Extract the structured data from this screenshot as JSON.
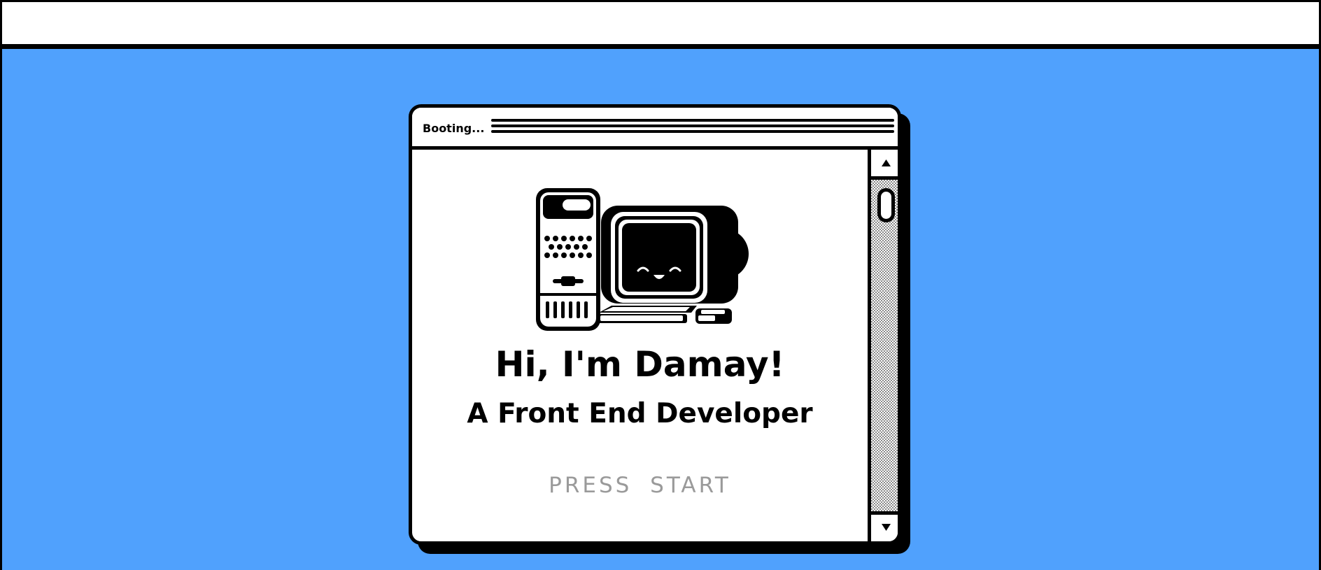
{
  "window": {
    "title": "Booting...",
    "headline": "Hi, I'm Damay!",
    "subheadline": "A Front End Developer",
    "press_start": "PRESS  START"
  },
  "icons": {
    "illustration": "smiling-retro-computer-icon",
    "scroll_up": "triangle-up-icon",
    "scroll_down": "triangle-down-icon"
  },
  "colors": {
    "desktop_background": "#50a1fd",
    "ink": "#000000",
    "window_background": "#ffffff",
    "press_start_text": "#9a9a9a"
  }
}
